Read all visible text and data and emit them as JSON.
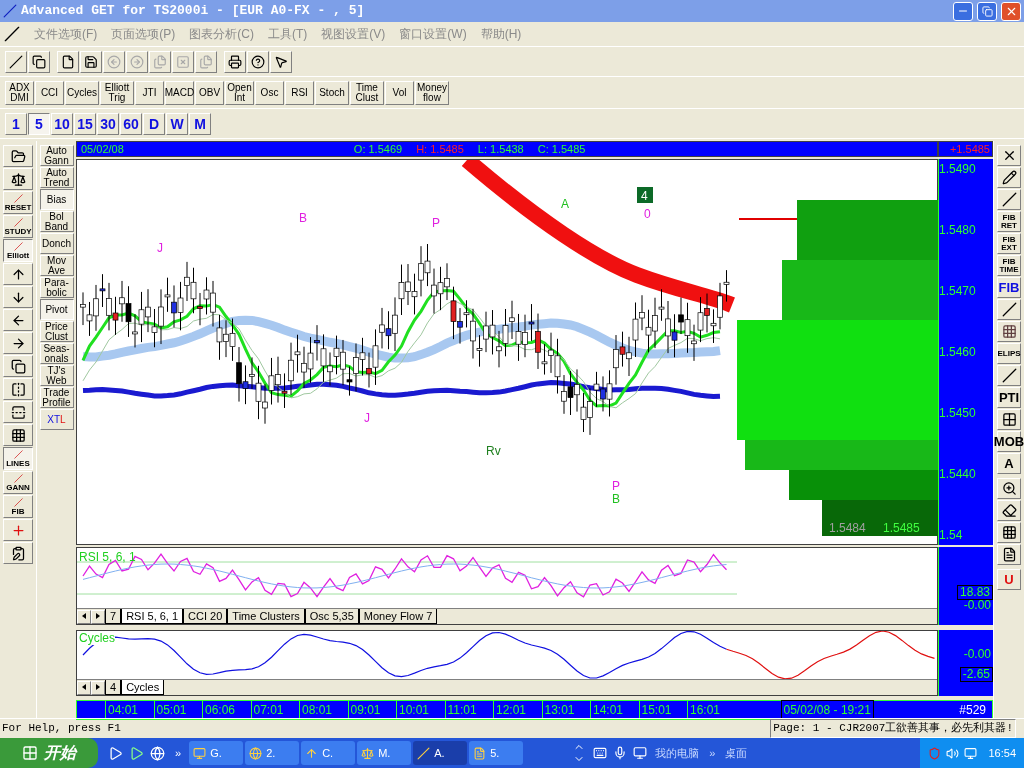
{
  "window": {
    "title": "Advanced GET for TS2000i - [EUR A0-FX - , 5]"
  },
  "menu": [
    "文件选项(F)",
    "页面选项(P)",
    "图表分析(C)",
    "工具(T)",
    "视图设置(V)",
    "窗口设置(W)",
    "帮助(H)"
  ],
  "toolbar": [
    {
      "disabled": false
    },
    {
      "disabled": false
    },
    {
      "disabled": false
    },
    {
      "disabled": false
    },
    {
      "disabled": true
    },
    {
      "disabled": true
    },
    {
      "disabled": true
    },
    {
      "disabled": true
    },
    {
      "disabled": true
    },
    {
      "disabled": false
    },
    {
      "disabled": false
    },
    {
      "disabled": false
    }
  ],
  "indicators": [
    {
      "lines": [
        "ADX",
        "DMI"
      ]
    },
    {
      "lines": [
        "CCI"
      ]
    },
    {
      "lines": [
        "Cycles"
      ]
    },
    {
      "lines": [
        "Elliott",
        "Trig"
      ]
    },
    {
      "lines": [
        "JTI"
      ]
    },
    {
      "lines": [
        "MACD"
      ]
    },
    {
      "lines": [
        "OBV"
      ]
    },
    {
      "lines": [
        "Open",
        "Int"
      ]
    },
    {
      "lines": [
        "Osc"
      ]
    },
    {
      "lines": [
        "RSI"
      ]
    },
    {
      "lines": [
        "Stoch"
      ]
    },
    {
      "lines": [
        "Time",
        "Clust"
      ]
    },
    {
      "lines": [
        "Vol"
      ]
    },
    {
      "lines": [
        "Money",
        "flow"
      ]
    }
  ],
  "timeframes": [
    {
      "label": "1",
      "selected": false
    },
    {
      "label": "5",
      "selected": true
    },
    {
      "label": "10",
      "selected": false
    },
    {
      "label": "15",
      "selected": false
    },
    {
      "label": "30",
      "selected": false
    },
    {
      "label": "60",
      "selected": false
    },
    {
      "label": "D",
      "selected": false
    },
    {
      "label": "W",
      "selected": false
    },
    {
      "label": "M",
      "selected": false
    }
  ],
  "left_tools": [
    {
      "kind": "icon",
      "selected": false
    },
    {
      "kind": "icon",
      "selected": false
    },
    {
      "kind": "labeled",
      "label": "RESET",
      "selected": false
    },
    {
      "kind": "labeled",
      "label": "STUDY",
      "selected": false
    },
    {
      "kind": "labeled",
      "label": "Elliott",
      "selected": true
    },
    {
      "kind": "icon",
      "selected": false
    },
    {
      "kind": "icon",
      "selected": false
    },
    {
      "kind": "icon",
      "selected": false
    },
    {
      "kind": "icon",
      "selected": false
    },
    {
      "kind": "icon",
      "selected": false
    },
    {
      "kind": "icon",
      "selected": false
    },
    {
      "kind": "icon",
      "selected": false
    },
    {
      "kind": "icon",
      "selected": false
    },
    {
      "kind": "labeled",
      "label": "LINES",
      "selected": true
    },
    {
      "kind": "labeled",
      "label": "GANN",
      "selected": false
    },
    {
      "kind": "labeled",
      "label": "FIB",
      "selected": false
    },
    {
      "kind": "icon",
      "selected": false
    },
    {
      "kind": "icon",
      "selected": false
    }
  ],
  "studies": [
    {
      "lines": [
        "Auto",
        "Gann"
      ],
      "selected": false
    },
    {
      "lines": [
        "Auto",
        "Trend"
      ],
      "selected": false
    },
    {
      "lines": [
        "Bias"
      ],
      "selected": true
    },
    {
      "lines": [
        "Bol",
        "Band"
      ],
      "selected": false
    },
    {
      "lines": [
        "Donch"
      ],
      "selected": false
    },
    {
      "lines": [
        "Mov",
        "Ave"
      ],
      "selected": false
    },
    {
      "lines": [
        "Para-",
        "bolic"
      ],
      "selected": false
    },
    {
      "lines": [
        "Pivot"
      ],
      "selected": true
    },
    {
      "lines": [
        "Price",
        "Clust"
      ],
      "selected": false
    },
    {
      "lines": [
        "Seas-",
        "onals"
      ],
      "selected": false
    },
    {
      "lines": [
        "TJ's",
        "Web"
      ],
      "selected": false
    },
    {
      "lines": [
        "Trade",
        "Profile"
      ],
      "selected": false
    },
    {
      "lines": [
        "XTL"
      ],
      "selected": false
    }
  ],
  "chart_header": {
    "date": "05/02/08",
    "open": "O: 1.5469",
    "high": "H: 1.5485",
    "low": "L: 1.5438",
    "close": "C: 1.5485",
    "change": "+1.5485"
  },
  "price_axis": [
    "1.5490",
    "1.5480",
    "1.5470",
    "1.5460",
    "1.5450",
    "1.5440",
    "1.54"
  ],
  "wave_labels": [
    {
      "text": "J",
      "color": "#e020e0"
    },
    {
      "text": "B",
      "color": "#e020e0"
    },
    {
      "text": "P",
      "color": "#e020e0"
    },
    {
      "text": "A",
      "color": "#20c020"
    },
    {
      "text": "0",
      "color": "#e020e0"
    },
    {
      "text": "J",
      "color": "#e020e0"
    },
    {
      "text": "Rv",
      "color": "#208020"
    },
    {
      "text": "P",
      "color": "#e020e0"
    },
    {
      "text": "B",
      "color": "#20c020"
    }
  ],
  "wave_count": "4",
  "profile_readings": [
    "1.5484",
    "1.5485"
  ],
  "rsi": {
    "title": "RSI 5, 6, 1",
    "value": "18.83",
    "zero": "-0.00"
  },
  "rsi_tabs": [
    {
      "label": "7",
      "selected": false
    },
    {
      "label": "RSI 5, 6, 1",
      "selected": true
    },
    {
      "label": "CCI 20",
      "selected": false
    },
    {
      "label": "Time Clusters",
      "selected": false
    },
    {
      "label": "Osc 5,35",
      "selected": false
    },
    {
      "label": "Money Flow 7",
      "selected": false
    }
  ],
  "cycles": {
    "title": "Cycles",
    "zero": "-0.00",
    "value": "-2.65"
  },
  "cycles_tabs": [
    {
      "label": "4",
      "selected": false
    },
    {
      "label": "Cycles",
      "selected": true
    }
  ],
  "time_axis": [
    "04:01",
    "05:01",
    "06:06",
    "07:01",
    "08:01",
    "09:01",
    "10:01",
    "11:01",
    "12:01",
    "13:01",
    "14:01",
    "15:01",
    "16:01"
  ],
  "time_stamp": "05/02/08 - 19:21",
  "bar_count": "#529",
  "right_tools": [
    {
      "kind": "icon"
    },
    {
      "kind": "icon"
    },
    {
      "kind": "icon"
    },
    {
      "kind": "labeled",
      "label": "FIB RET"
    },
    {
      "kind": "labeled",
      "label": "FIB EXT"
    },
    {
      "kind": "labeled",
      "label": "FIB TIME"
    },
    {
      "kind": "labeled",
      "label": "FIB"
    },
    {
      "kind": "icon"
    },
    {
      "kind": "icon"
    },
    {
      "kind": "labeled",
      "label": "ELIPS"
    },
    {
      "kind": "icon"
    },
    {
      "kind": "labeled",
      "label": "PTI"
    },
    {
      "kind": "icon"
    },
    {
      "kind": "labeled",
      "label": "MOB"
    },
    {
      "kind": "labeled",
      "label": "A"
    },
    {
      "kind": "icon"
    },
    {
      "kind": "icon"
    },
    {
      "kind": "icon"
    },
    {
      "kind": "icon"
    },
    {
      "kind": "labeled",
      "label": "U"
    }
  ],
  "status_bar": {
    "help": "For Help, press F1",
    "page": "Page: 1 - CJR2007工欲善其事，必先利其器!"
  },
  "taskbar": {
    "start": "开始",
    "tasks": [
      {
        "label": "G.",
        "selected": false
      },
      {
        "label": "2.",
        "selected": false
      },
      {
        "label": "C.",
        "selected": false
      },
      {
        "label": "M.",
        "selected": false
      },
      {
        "label": "A.",
        "selected": true
      },
      {
        "label": "5.",
        "selected": false
      }
    ],
    "chevron": "»",
    "tray_links": [
      "我的电脑",
      "»",
      "桌面"
    ],
    "clock": "16:54"
  }
}
